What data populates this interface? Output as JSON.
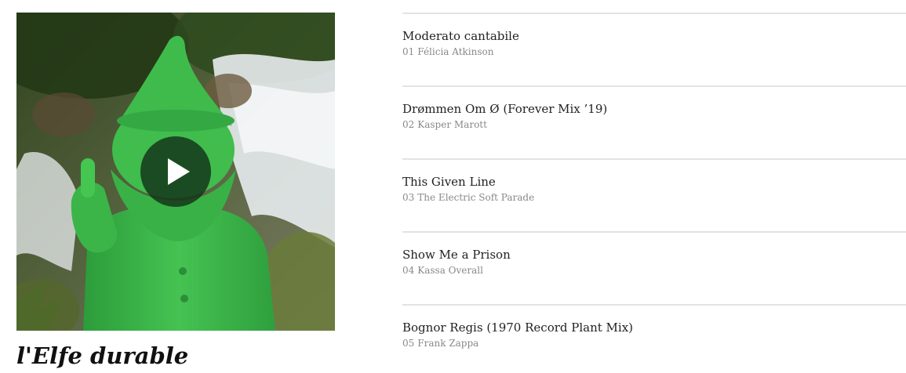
{
  "album": {
    "title": "l'Elfe durable",
    "cover_image": "green gnome statue showing middle finger in front of a waterfall"
  },
  "player": {
    "play_icon": "play-icon"
  },
  "tracks": [
    {
      "number": "01",
      "title": "Moderato cantabile",
      "artist": "Félicia Atkinson"
    },
    {
      "number": "02",
      "title": "Drømmen Om Ø (Forever Mix ’19)",
      "artist": "Kasper Marott"
    },
    {
      "number": "03",
      "title": "This Given Line",
      "artist": "The Electric Soft Parade"
    },
    {
      "number": "04",
      "title": "Show Me a Prison",
      "artist": "Kassa Overall"
    },
    {
      "number": "05",
      "title": "Bognor Regis (1970 Record Plant Mix)",
      "artist": "Frank Zappa"
    }
  ],
  "colors": {
    "divider": "#e3e3e3",
    "subtext": "#888888",
    "gnome_green": "#3db84a"
  }
}
